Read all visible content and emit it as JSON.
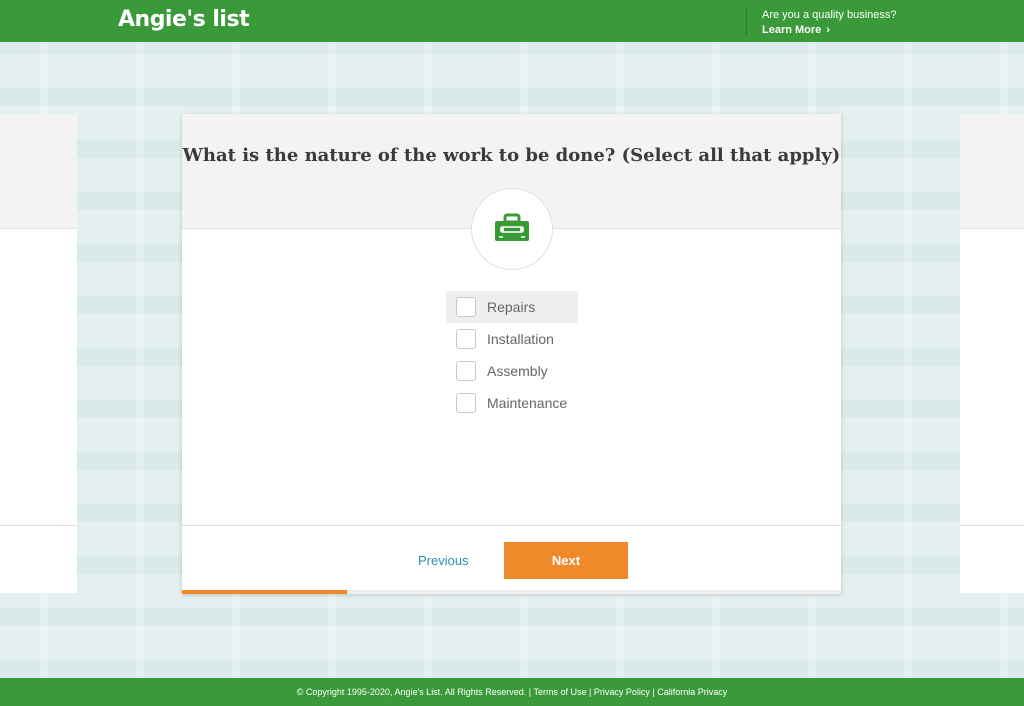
{
  "header": {
    "logo_text": "Angie's list",
    "biz_question": "Are you a quality business?",
    "learn_more": "Learn More",
    "chevron": "›"
  },
  "question": {
    "title": "What is the nature of the work to be done? (Select all that apply)",
    "icon": "toolbox-icon",
    "icon_color": "#3a9a3a"
  },
  "options": [
    {
      "label": "Repairs",
      "checked": false
    },
    {
      "label": "Installation",
      "checked": false
    },
    {
      "label": "Assembly",
      "checked": false
    },
    {
      "label": "Maintenance",
      "checked": false
    }
  ],
  "navigation": {
    "previous_label": "Previous",
    "next_label": "Next"
  },
  "progress": {
    "fraction": 0.25,
    "color": "#f0892a"
  },
  "footer": {
    "copyright": "© Copyright 1995-2020, Angie's List. All Rights Reserved.",
    "separator": "|",
    "terms": "Terms of Use",
    "privacy": "Privacy Policy",
    "california": "California Privacy"
  },
  "colors": {
    "brand_green": "#3a9a3a",
    "accent_orange": "#f0892a",
    "link_blue": "#2e8fb3"
  }
}
